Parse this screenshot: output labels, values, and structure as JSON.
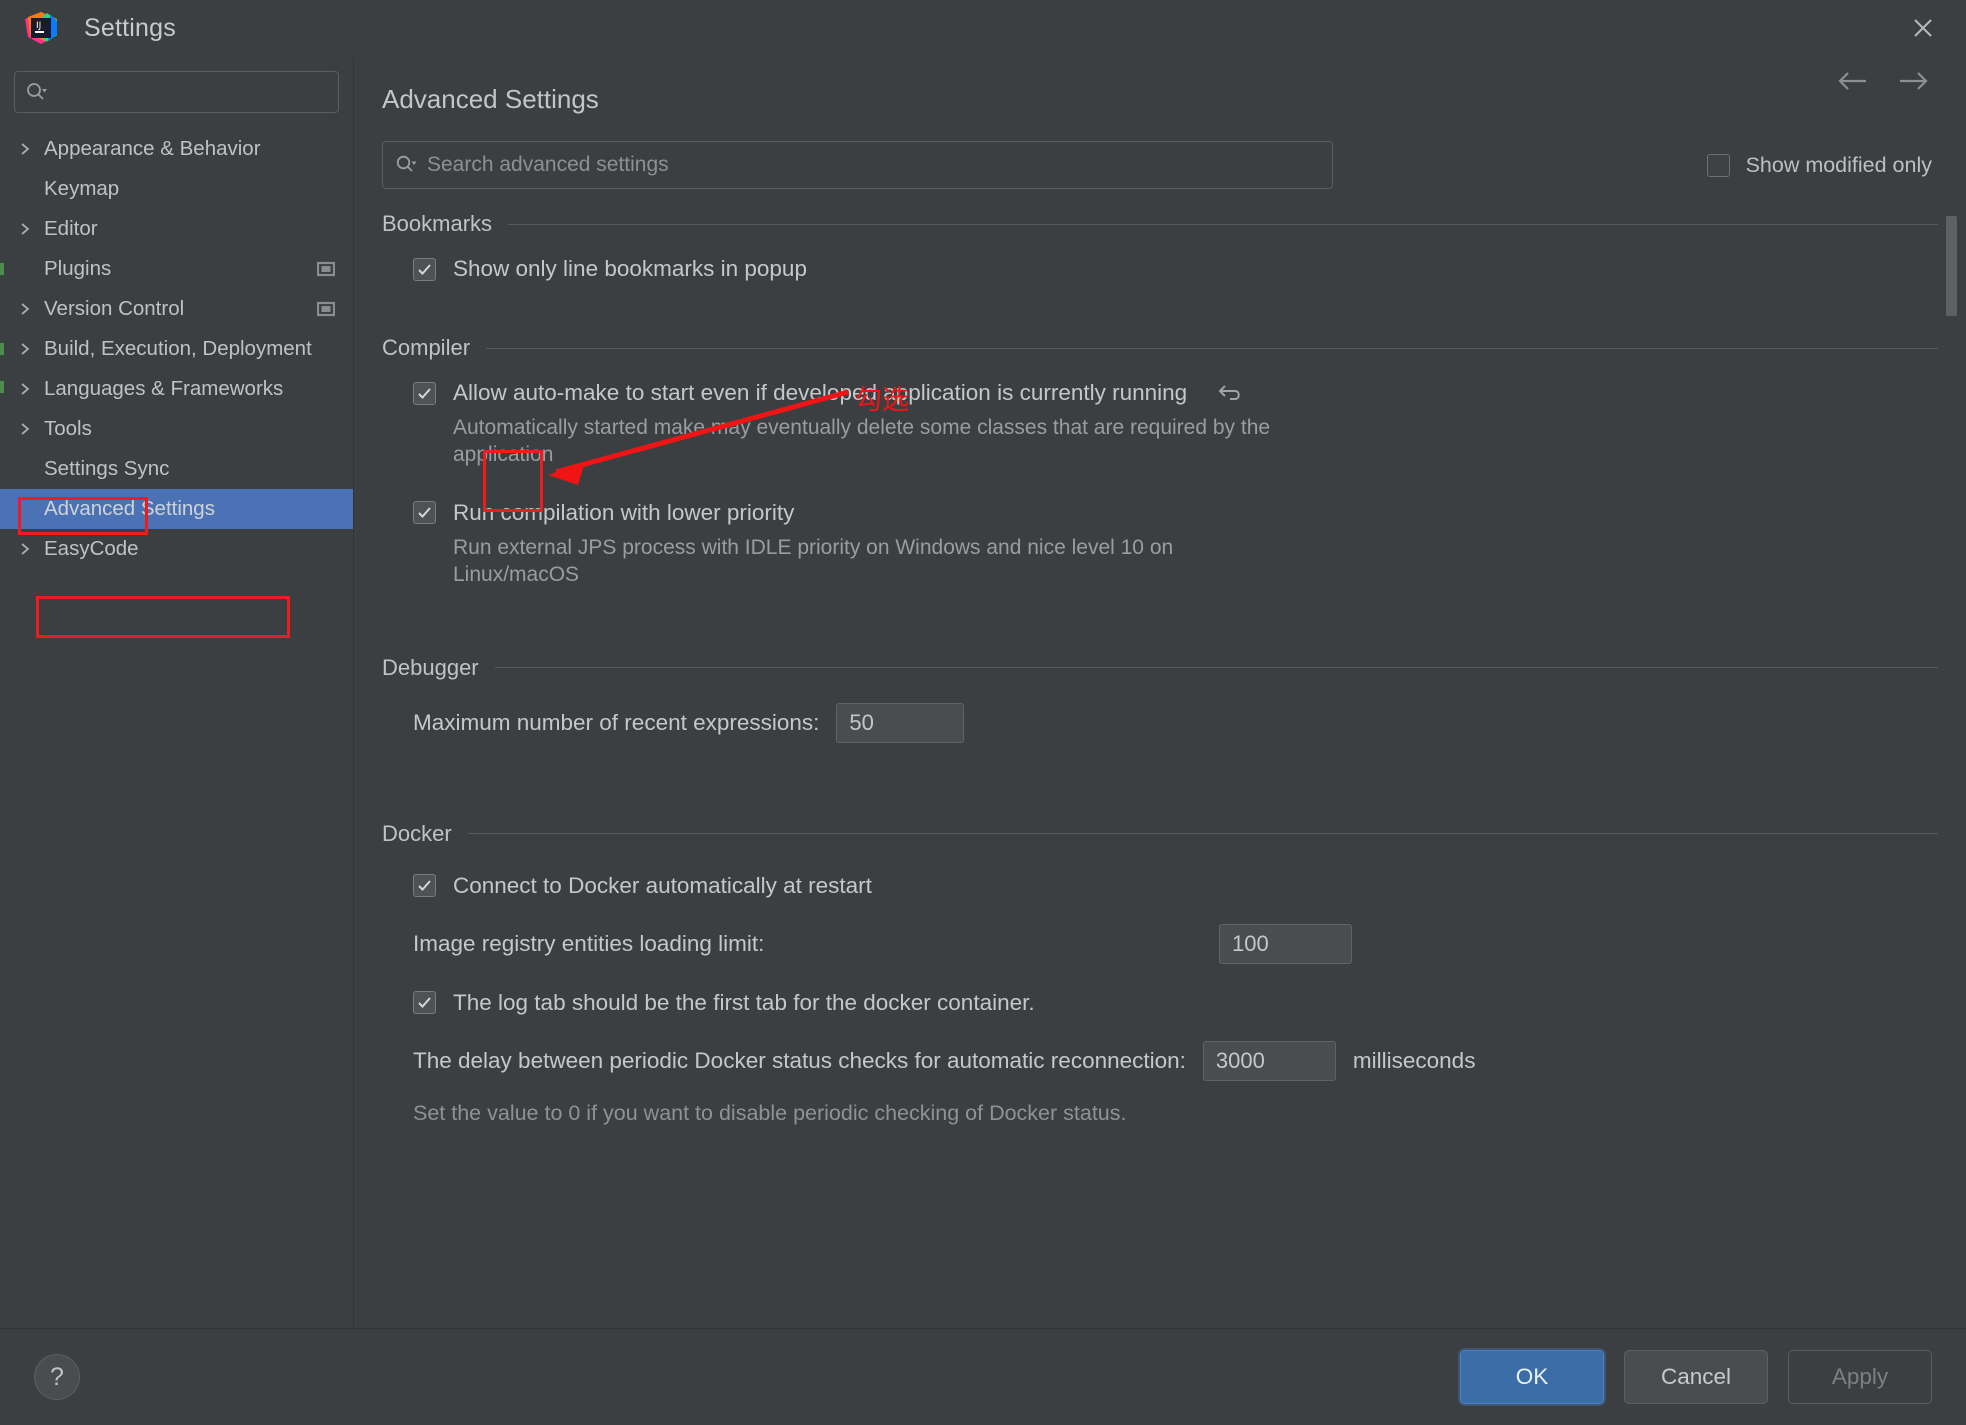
{
  "window": {
    "title": "Settings",
    "logo_icon": "intellij-idea-logo",
    "close_icon": "close-icon"
  },
  "sidebar": {
    "search": {
      "placeholder": "",
      "value": "",
      "icon": "search-icon"
    },
    "items": [
      {
        "label": "Appearance & Behavior",
        "expandable": true,
        "selected": false,
        "detach": false
      },
      {
        "label": "Keymap",
        "expandable": false,
        "selected": false,
        "detach": false
      },
      {
        "label": "Editor",
        "expandable": true,
        "selected": false,
        "detach": false
      },
      {
        "label": "Plugins",
        "expandable": false,
        "selected": false,
        "detach": true
      },
      {
        "label": "Version Control",
        "expandable": true,
        "selected": false,
        "detach": true
      },
      {
        "label": "Build, Execution, Deployment",
        "expandable": true,
        "selected": false,
        "detach": false
      },
      {
        "label": "Languages & Frameworks",
        "expandable": true,
        "selected": false,
        "detach": false
      },
      {
        "label": "Tools",
        "expandable": true,
        "selected": false,
        "detach": false,
        "annotated": true
      },
      {
        "label": "Settings Sync",
        "expandable": false,
        "selected": false,
        "detach": false
      },
      {
        "label": "Advanced Settings",
        "expandable": false,
        "selected": true,
        "detach": false,
        "annotated": true
      },
      {
        "label": "EasyCode",
        "expandable": true,
        "selected": false,
        "detach": false
      }
    ]
  },
  "main": {
    "page_title": "Advanced Settings",
    "nav": {
      "back_icon": "arrow-left-icon",
      "forward_icon": "arrow-right-icon"
    },
    "search": {
      "placeholder": "Search advanced settings",
      "value": "",
      "icon": "search-icon"
    },
    "show_modified_only": {
      "label": "Show modified only",
      "checked": false
    },
    "groups": [
      {
        "title": "Bookmarks",
        "rows": [
          {
            "type": "checkbox",
            "label": "Show only line bookmarks in popup",
            "checked": true
          }
        ]
      },
      {
        "title": "Compiler",
        "rows": [
          {
            "type": "checkbox",
            "label": "Allow auto-make to start even if developed application is currently running",
            "checked": true,
            "revert_icon": "revert-arrow-icon",
            "description": "Automatically started make may eventually delete some classes that are required by the application",
            "annotated": true
          },
          {
            "type": "checkbox",
            "label": "Run compilation with lower priority",
            "checked": true,
            "description": "Run external JPS process with IDLE priority on Windows and nice level 10 on Linux/macOS"
          }
        ]
      },
      {
        "title": "Debugger",
        "rows": [
          {
            "type": "field",
            "label": "Maximum number of recent expressions:",
            "value": "50"
          }
        ]
      },
      {
        "title": "Docker",
        "rows": [
          {
            "type": "checkbox",
            "label": "Connect to Docker automatically at restart",
            "checked": true
          },
          {
            "type": "field",
            "label": "Image registry entities loading limit:",
            "value": "100"
          },
          {
            "type": "checkbox",
            "label": "The log tab should be the first tab for the docker container.",
            "checked": true
          },
          {
            "type": "field",
            "label": "The delay between periodic Docker status checks for automatic reconnection:",
            "value": "3000",
            "unit": "milliseconds"
          },
          {
            "type": "hint",
            "label": "Set the value to 0 if you want to disable periodic checking of Docker status."
          }
        ]
      }
    ]
  },
  "annotation": {
    "text": "勾选",
    "color": "#f01414"
  },
  "footer": {
    "help_label": "?",
    "ok_label": "OK",
    "cancel_label": "Cancel",
    "apply_label": "Apply"
  },
  "colors": {
    "window_bg": "#3c3f41",
    "selection_blue": "#4a72b5",
    "primary_button": "#3b6ea8",
    "annotation_red": "#ee1c1c",
    "text": "#c5c7c9",
    "muted_text": "#9a9da0"
  }
}
